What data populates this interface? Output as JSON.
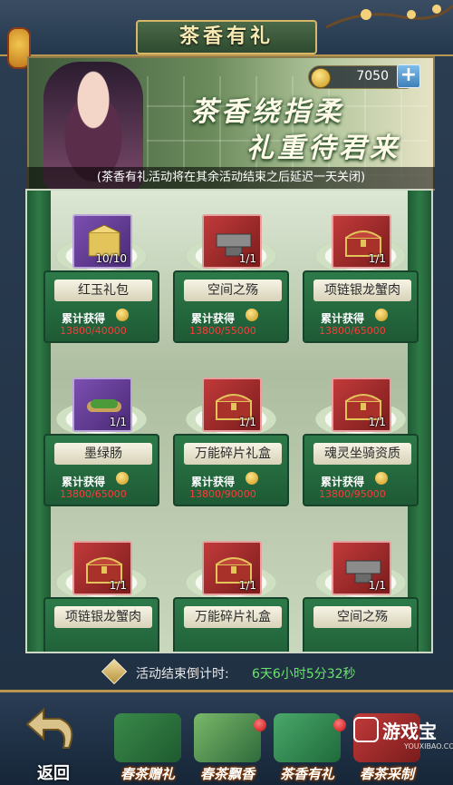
{
  "header": {
    "title": "茶香有礼"
  },
  "banner": {
    "coin_value": "7050",
    "plus_label": "+",
    "slogan_line1": "茶香绕指柔",
    "slogan_line2": "礼重待君来",
    "notice": "(茶香有礼活动将在其余活动结束之后延迟一天关闭)"
  },
  "rewards": [
    {
      "name": "红玉礼包",
      "count": "10/10",
      "label": "累计获得",
      "progress": "13800/40000",
      "box": "purple",
      "icon": "gift-bag-icon"
    },
    {
      "name": "空间之殇",
      "count": "1/1",
      "label": "累计获得",
      "progress": "13800/55000",
      "box": "red",
      "icon": "anvil-icon"
    },
    {
      "name": "项链银龙蟹肉",
      "count": "1/1",
      "label": "累计获得",
      "progress": "13800/65000",
      "box": "red",
      "icon": "treasure-chest-icon"
    },
    {
      "name": "墨绿肠",
      "count": "1/1",
      "label": "累计获得",
      "progress": "13800/65000",
      "box": "purple",
      "icon": "sausage-icon"
    },
    {
      "name": "万能碎片礼盒",
      "count": "1/1",
      "label": "累计获得",
      "progress": "13800/90000",
      "box": "red",
      "icon": "treasure-chest-icon"
    },
    {
      "name": "魂灵坐骑资质",
      "count": "1/1",
      "label": "累计获得",
      "progress": "13800/95000",
      "box": "red",
      "icon": "treasure-chest-icon"
    },
    {
      "name": "项链银龙蟹肉",
      "count": "1/1",
      "box": "red",
      "icon": "treasure-chest-icon"
    },
    {
      "name": "万能碎片礼盒",
      "count": "1/1",
      "box": "red",
      "icon": "treasure-chest-icon"
    },
    {
      "name": "空间之殇",
      "count": "1/1",
      "box": "red",
      "icon": "anvil-icon"
    }
  ],
  "countdown": {
    "label": "活动结束倒计时:",
    "value": "6天6小时5分32秒"
  },
  "bottom": {
    "back_label": "返回",
    "tabs": [
      {
        "label": "春茶赠礼",
        "has_dot": false
      },
      {
        "label": "春茶飘香",
        "has_dot": true
      },
      {
        "label": "茶香有礼",
        "has_dot": true
      },
      {
        "label": "春茶采制",
        "has_dot": false
      }
    ]
  },
  "watermark": {
    "text": "游戏宝",
    "url": "YOUXIBAO.COM"
  },
  "colors": {
    "progress_red": "#ff3a3a",
    "countdown_green": "#69e46b",
    "card_green": "#2d7a49"
  }
}
